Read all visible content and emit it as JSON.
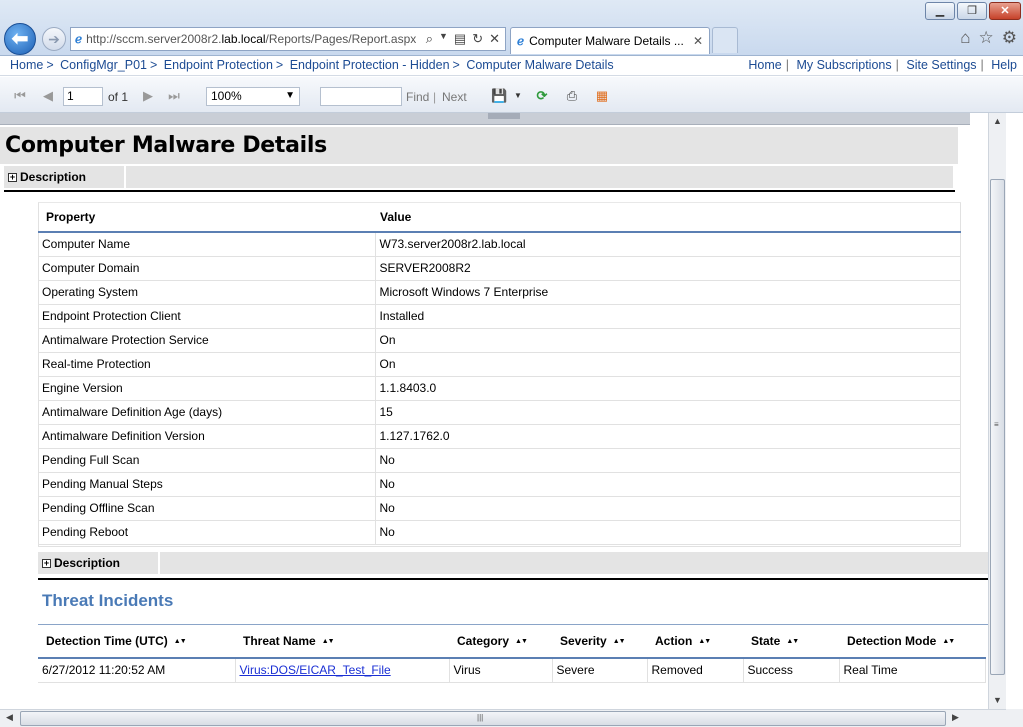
{
  "browser": {
    "url_prefix": "http://sccm.server2008r2.",
    "url_domain": "lab.local",
    "url_suffix": "/Reports/Pages/Report.aspx",
    "tab_title": "Computer Malware Details ...",
    "window_buttons": [
      "minimize",
      "restore",
      "close"
    ]
  },
  "breadcrumb": {
    "items": [
      "Home",
      "ConfigMgr_P01",
      "Endpoint Protection",
      "Endpoint Protection - Hidden",
      "Computer Malware Details"
    ],
    "links": [
      "Home",
      "My Subscriptions",
      "Site Settings",
      "Help"
    ]
  },
  "toolbar": {
    "page_value": "1",
    "page_of": "of 1",
    "zoom": "100%",
    "find_label": "Find",
    "next_label": "Next",
    "find_value": ""
  },
  "report": {
    "title": "Computer Malware Details",
    "description_label": "Description",
    "props_headers": {
      "property": "Property",
      "value": "Value"
    },
    "properties": [
      {
        "k": "Computer Name",
        "v": "W73.server2008r2.lab.local"
      },
      {
        "k": "Computer Domain",
        "v": "SERVER2008R2"
      },
      {
        "k": "Operating System",
        "v": "Microsoft Windows 7 Enterprise"
      },
      {
        "k": "Endpoint Protection Client",
        "v": "Installed"
      },
      {
        "k": "Antimalware Protection Service",
        "v": "On"
      },
      {
        "k": "Real-time Protection",
        "v": "On"
      },
      {
        "k": "Engine Version",
        "v": "1.1.8403.0"
      },
      {
        "k": "Antimalware Definition Age (days)",
        "v": "15"
      },
      {
        "k": "Antimalware Definition Version",
        "v": "1.127.1762.0"
      },
      {
        "k": "Pending Full Scan",
        "v": "No"
      },
      {
        "k": "Pending Manual Steps",
        "v": "No"
      },
      {
        "k": "Pending Offline Scan",
        "v": "No"
      },
      {
        "k": "Pending Reboot",
        "v": "No"
      }
    ],
    "description_label_2": "Description",
    "threats_title": "Threat Incidents",
    "threat_headers": [
      "Detection Time (UTC)",
      "Threat Name",
      "Category",
      "Severity",
      "Action",
      "State",
      "Detection Mode"
    ],
    "threats": [
      {
        "time": "6/27/2012 11:20:52 AM",
        "name": "Virus:DOS/EICAR_Test_File",
        "category": "Virus",
        "severity": "Severe",
        "action": "Removed",
        "state": "Success",
        "mode": "Real Time"
      }
    ]
  }
}
